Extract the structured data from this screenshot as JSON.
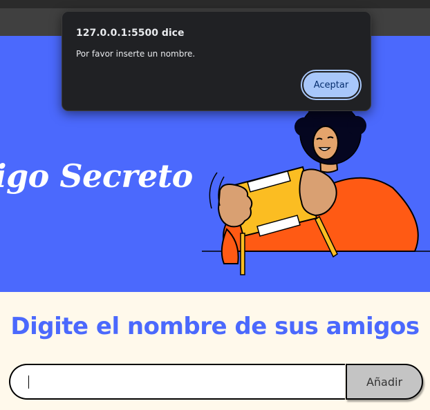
{
  "hero": {
    "title": "igo Secreto"
  },
  "main": {
    "subtitle": "Digite el nombre de sus amigos",
    "name_input_value": "",
    "add_button_label": "Añadir"
  },
  "alert": {
    "title": "127.0.0.1:5500 dice",
    "message": "Por favor inserte un nombre.",
    "ok_label": "Aceptar"
  },
  "colors": {
    "hero_bg": "#4b69fd",
    "content_bg": "#fff9eb",
    "accent": "#4b69fd",
    "button_bg": "#c4c4c4",
    "dialog_bg": "#202124",
    "dialog_button": "#a8c7fa"
  },
  "icons": {
    "hero_illustration": "person-with-gift-box-illustration"
  }
}
